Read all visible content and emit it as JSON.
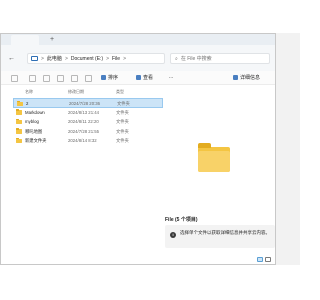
{
  "window": {
    "new_tab_label": "+",
    "back_icon": "arrow-left-icon",
    "forward_icon": "arrow-right-icon",
    "up_icon": "arrow-up-icon",
    "refresh_icon": "refresh-icon"
  },
  "address": {
    "crumbs": [
      "此电脑",
      "Document (E:)",
      "File"
    ],
    "separator": ">",
    "search_placeholder": "在 File 中搜索"
  },
  "toolbar": {
    "sort_label": "排序",
    "view_label": "查看",
    "more_label": "...",
    "details_label": "详细信息"
  },
  "columns": {
    "name": "名称",
    "date": "修改日期",
    "type": "类型"
  },
  "files": [
    {
      "name": "2",
      "date": "2024/7/28 20:36",
      "type": "文件夹"
    },
    {
      "name": "Markdown",
      "date": "2024/8/13 21:44",
      "type": "文件夹"
    },
    {
      "name": "myblog",
      "date": "2024/8/11 22:20",
      "type": "文件夹"
    },
    {
      "name": "哪吒地图",
      "date": "2024/7/28 21:55",
      "type": "文件夹"
    },
    {
      "name": "新建文件夹",
      "date": "2024/8/14 8:32",
      "type": "文件夹"
    }
  ],
  "preview": {
    "title": "File (5 个项目)",
    "info_text": "选择单个文件以获取详细信息并共享云内容。"
  }
}
